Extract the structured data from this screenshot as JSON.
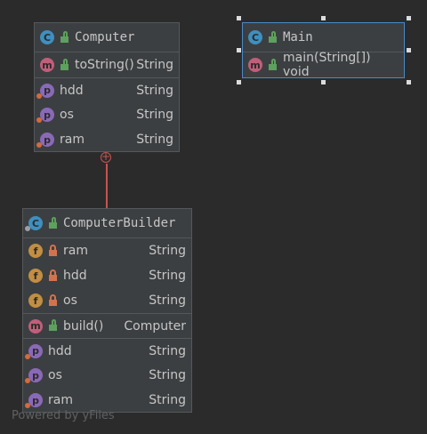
{
  "footer": "Powered by yFiles",
  "computer": {
    "title": "Computer",
    "methods": [
      {
        "name": "toString()",
        "type": "String"
      }
    ],
    "properties": [
      {
        "name": "hdd",
        "type": "String"
      },
      {
        "name": "os",
        "type": "String"
      },
      {
        "name": "ram",
        "type": "String"
      }
    ]
  },
  "main": {
    "title": "Main",
    "methods": [
      {
        "name": "main(String[]) void"
      }
    ]
  },
  "builder": {
    "title": "ComputerBuilder",
    "fields": [
      {
        "name": "ram",
        "type": "String"
      },
      {
        "name": "hdd",
        "type": "String"
      },
      {
        "name": "os",
        "type": "String"
      }
    ],
    "methods": [
      {
        "name": "build()",
        "type": "Computer"
      }
    ],
    "properties": [
      {
        "name": "hdd",
        "type": "String"
      },
      {
        "name": "os",
        "type": "String"
      },
      {
        "name": "ram",
        "type": "String"
      }
    ]
  },
  "icons": {
    "class": "C",
    "method": "m",
    "property": "p",
    "field": "f"
  }
}
